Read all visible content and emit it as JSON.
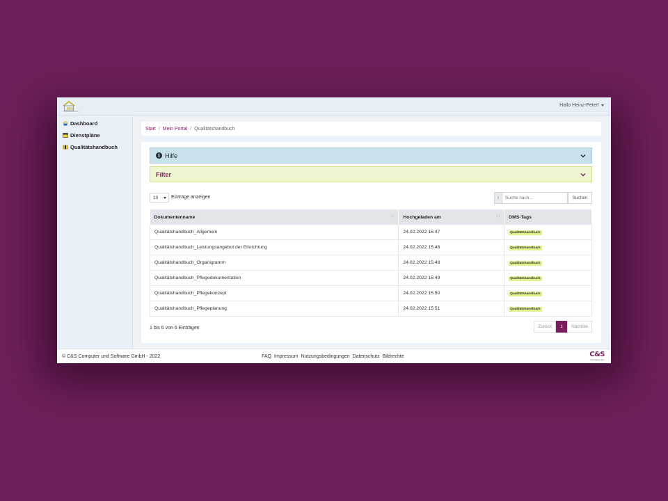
{
  "header": {
    "logo_text": "PDS",
    "user_greeting": "Hallo Heinz-Peter!"
  },
  "sidebar": {
    "items": [
      {
        "label": "Dashboard",
        "icon": "house-icon"
      },
      {
        "label": "Dienstpläne",
        "icon": "calendar-icon"
      },
      {
        "label": "Qualitätshandbuch",
        "icon": "books-icon"
      }
    ]
  },
  "breadcrumb": {
    "items": [
      "Start",
      "Mein Portal",
      "Qualitätshandbuch"
    ],
    "separator": "/"
  },
  "panels": {
    "hilfe": {
      "label": "Hilfe",
      "color": "#c8e1ea"
    },
    "filter": {
      "label": "Filter",
      "color": "#eef6cf"
    }
  },
  "table_controls": {
    "page_length": "10",
    "length_label": "Einträge anzeigen",
    "search_info": "i",
    "search_placeholder": "Suche nach...",
    "search_button": "Suchen"
  },
  "table": {
    "columns": [
      "Dokumentenname",
      "Hochgeladen am",
      "DMS-Tags"
    ],
    "rows": [
      {
        "name": "Qualitätshandbuch_Allgemein",
        "date": "24.02.2022 15:47",
        "tag": "Qualitätshandbuch"
      },
      {
        "name": "Qualitätshandbuch_Leistungsangebot der Einrichtung",
        "date": "24.02.2022 15:48",
        "tag": "Qualitätshandbuch"
      },
      {
        "name": "Qualitätshandbuch_Organigramm",
        "date": "24.02.2022 15:48",
        "tag": "Qualitätshandbuch"
      },
      {
        "name": "Qualitätshandbuch_Pflegedokumentation",
        "date": "24.02.2022 15:49",
        "tag": "Qualitätshandbuch"
      },
      {
        "name": "Qualitätshandbuch_Pflegekonzept",
        "date": "24.02.2022 15:50",
        "tag": "Qualitätshandbuch"
      },
      {
        "name": "Qualitätshandbuch_Pflegeplanung",
        "date": "24.02.2022 15:51",
        "tag": "Qualitätshandbuch"
      }
    ],
    "info": "1 bis 6 von 6 Einträgen"
  },
  "pagination": {
    "prev": "Zurück",
    "current": "1",
    "next": "Nächste"
  },
  "footer": {
    "copyright": "© C&S Computer und Software GmbH - 2022",
    "links": [
      "FAQ",
      "Impressum",
      "Nutzungsbedingungen",
      "Datenschutz",
      "Bildrechte"
    ],
    "brand": "C&S",
    "brand_tagline": "managing care"
  },
  "colors": {
    "accent": "#7a1e5e",
    "background": "#6c1f58",
    "tag": "#e3f08e"
  }
}
